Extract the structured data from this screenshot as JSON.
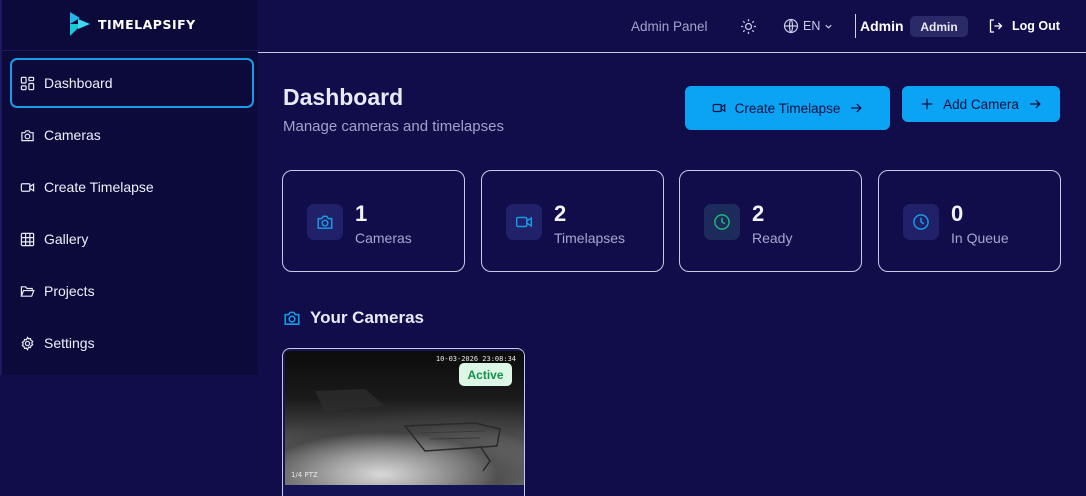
{
  "brand": {
    "name": "TIMELAPSIFY"
  },
  "sidebar": {
    "items": [
      {
        "label": "Dashboard",
        "icon": "grid-icon",
        "active": true
      },
      {
        "label": "Cameras",
        "icon": "camera-icon"
      },
      {
        "label": "Create Timelapse",
        "icon": "video-icon"
      },
      {
        "label": "Gallery",
        "icon": "gallery-grid-icon"
      },
      {
        "label": "Projects",
        "icon": "folder-open-icon"
      },
      {
        "label": "Settings",
        "icon": "gear-icon"
      }
    ]
  },
  "header": {
    "admin_panel": "Admin Panel",
    "theme_icon": "sun-icon",
    "language": "EN",
    "user_name": "Admin",
    "role_badge": "Admin",
    "logout": "Log Out"
  },
  "main": {
    "title": "Dashboard",
    "subtitle": "Manage cameras and timelapses",
    "buttons": {
      "create_timelapse": "Create Timelapse",
      "add_camera": "Add Camera"
    },
    "stats": [
      {
        "value": "1",
        "label": "Cameras",
        "icon": "camera-icon",
        "color": "#1a9be8"
      },
      {
        "value": "2",
        "label": "Timelapses",
        "icon": "video-icon",
        "color": "#1a9be8"
      },
      {
        "value": "2",
        "label": "Ready",
        "icon": "clock-icon",
        "color": "#1fb87a"
      },
      {
        "value": "0",
        "label": "In Queue",
        "icon": "clock-icon",
        "color": "#1a9be8"
      }
    ],
    "cameras_section": {
      "title": "Your Cameras",
      "cameras": [
        {
          "timestamp": "10-03-2026 23:08:34",
          "feed_label": "1/4 PTZ",
          "status": "Active"
        }
      ]
    }
  },
  "colors": {
    "background": "#110d4a",
    "sidebar": "#0b0a3b",
    "accent": "#0ba4f5",
    "active_status": "#14904a"
  }
}
